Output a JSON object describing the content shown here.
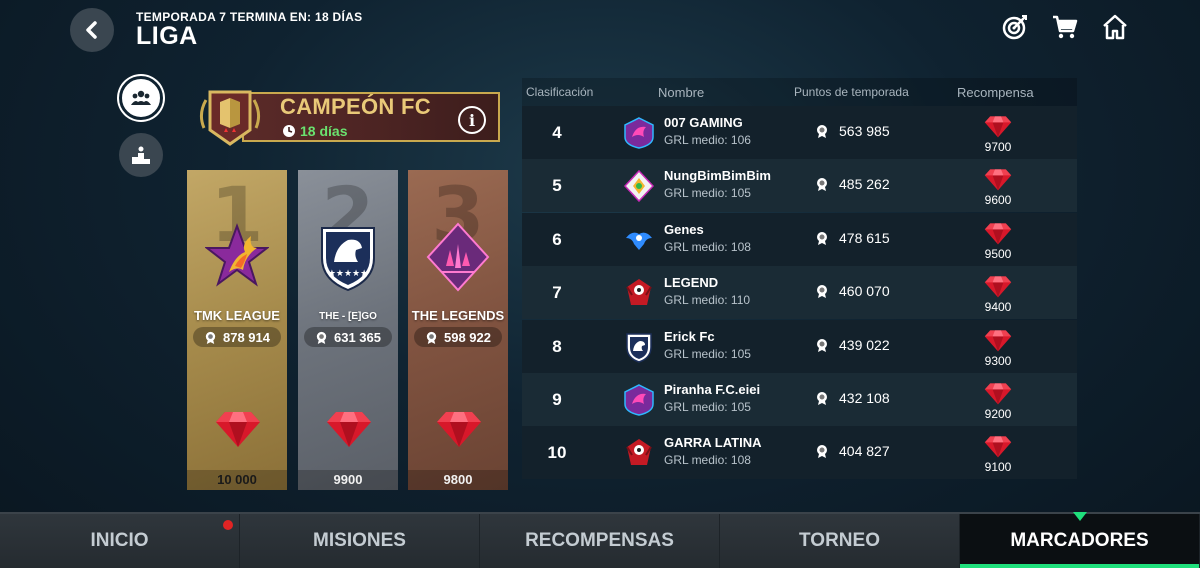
{
  "header": {
    "season_text": "TEMPORADA 7 TERMINA EN: 18 DÍAS",
    "title": "LIGA",
    "icons": [
      "back-chevron-icon",
      "target-icon",
      "cart-icon",
      "home-icon"
    ]
  },
  "side": {
    "icons": [
      "group-icon",
      "podium-icon"
    ]
  },
  "league": {
    "name": "CAMPEÓN FC",
    "days": "18 días",
    "info_label": "i"
  },
  "podium": [
    {
      "position": "1",
      "name": "TMK LEAGUE",
      "points": "878 914",
      "reward": "10 000"
    },
    {
      "position": "2",
      "name": "THE - [E]GO",
      "points": "631 365",
      "reward": "9900"
    },
    {
      "position": "3",
      "name": "THE LEGENDS",
      "points": "598 922",
      "reward": "9800"
    }
  ],
  "table": {
    "headers": {
      "rank": "Clasificación",
      "name": "Nombre",
      "points": "Puntos de temporada",
      "reward": "Recompensa"
    },
    "rows": [
      {
        "rank": "4",
        "name": "007    GAMING",
        "ovr": "GRL medio: 106",
        "points": "563 985",
        "reward": "9700"
      },
      {
        "rank": "5",
        "name": "NungBimBimBim",
        "ovr": "GRL medio: 105",
        "points": "485 262",
        "reward": "9600"
      },
      {
        "rank": "6",
        "name": "Genes",
        "ovr": "GRL medio: 108",
        "points": "478 615",
        "reward": "9500"
      },
      {
        "rank": "7",
        "name": "LEGEND",
        "ovr": "GRL medio: 110",
        "points": "460 070",
        "reward": "9400"
      },
      {
        "rank": "8",
        "name": "Erick Fc",
        "ovr": "GRL medio: 105",
        "points": "439 022",
        "reward": "9300"
      },
      {
        "rank": "9",
        "name": "Piranha F.C.eiei",
        "ovr": "GRL medio: 105",
        "points": "432 108",
        "reward": "9200"
      },
      {
        "rank": "10",
        "name": "GARRA LATINA",
        "ovr": "GRL medio: 108",
        "points": "404 827",
        "reward": "9100"
      }
    ]
  },
  "nav": {
    "items": [
      "INICIO",
      "MISIONES",
      "RECOMPENSAS",
      "TORNEO",
      "MARCADORES"
    ],
    "active": "MARCADORES"
  },
  "colors": {
    "accent_green": "#1fe07c",
    "gold_text": "#e9c978",
    "days_green": "#6ae26f",
    "gem_red": "#d8182a"
  }
}
